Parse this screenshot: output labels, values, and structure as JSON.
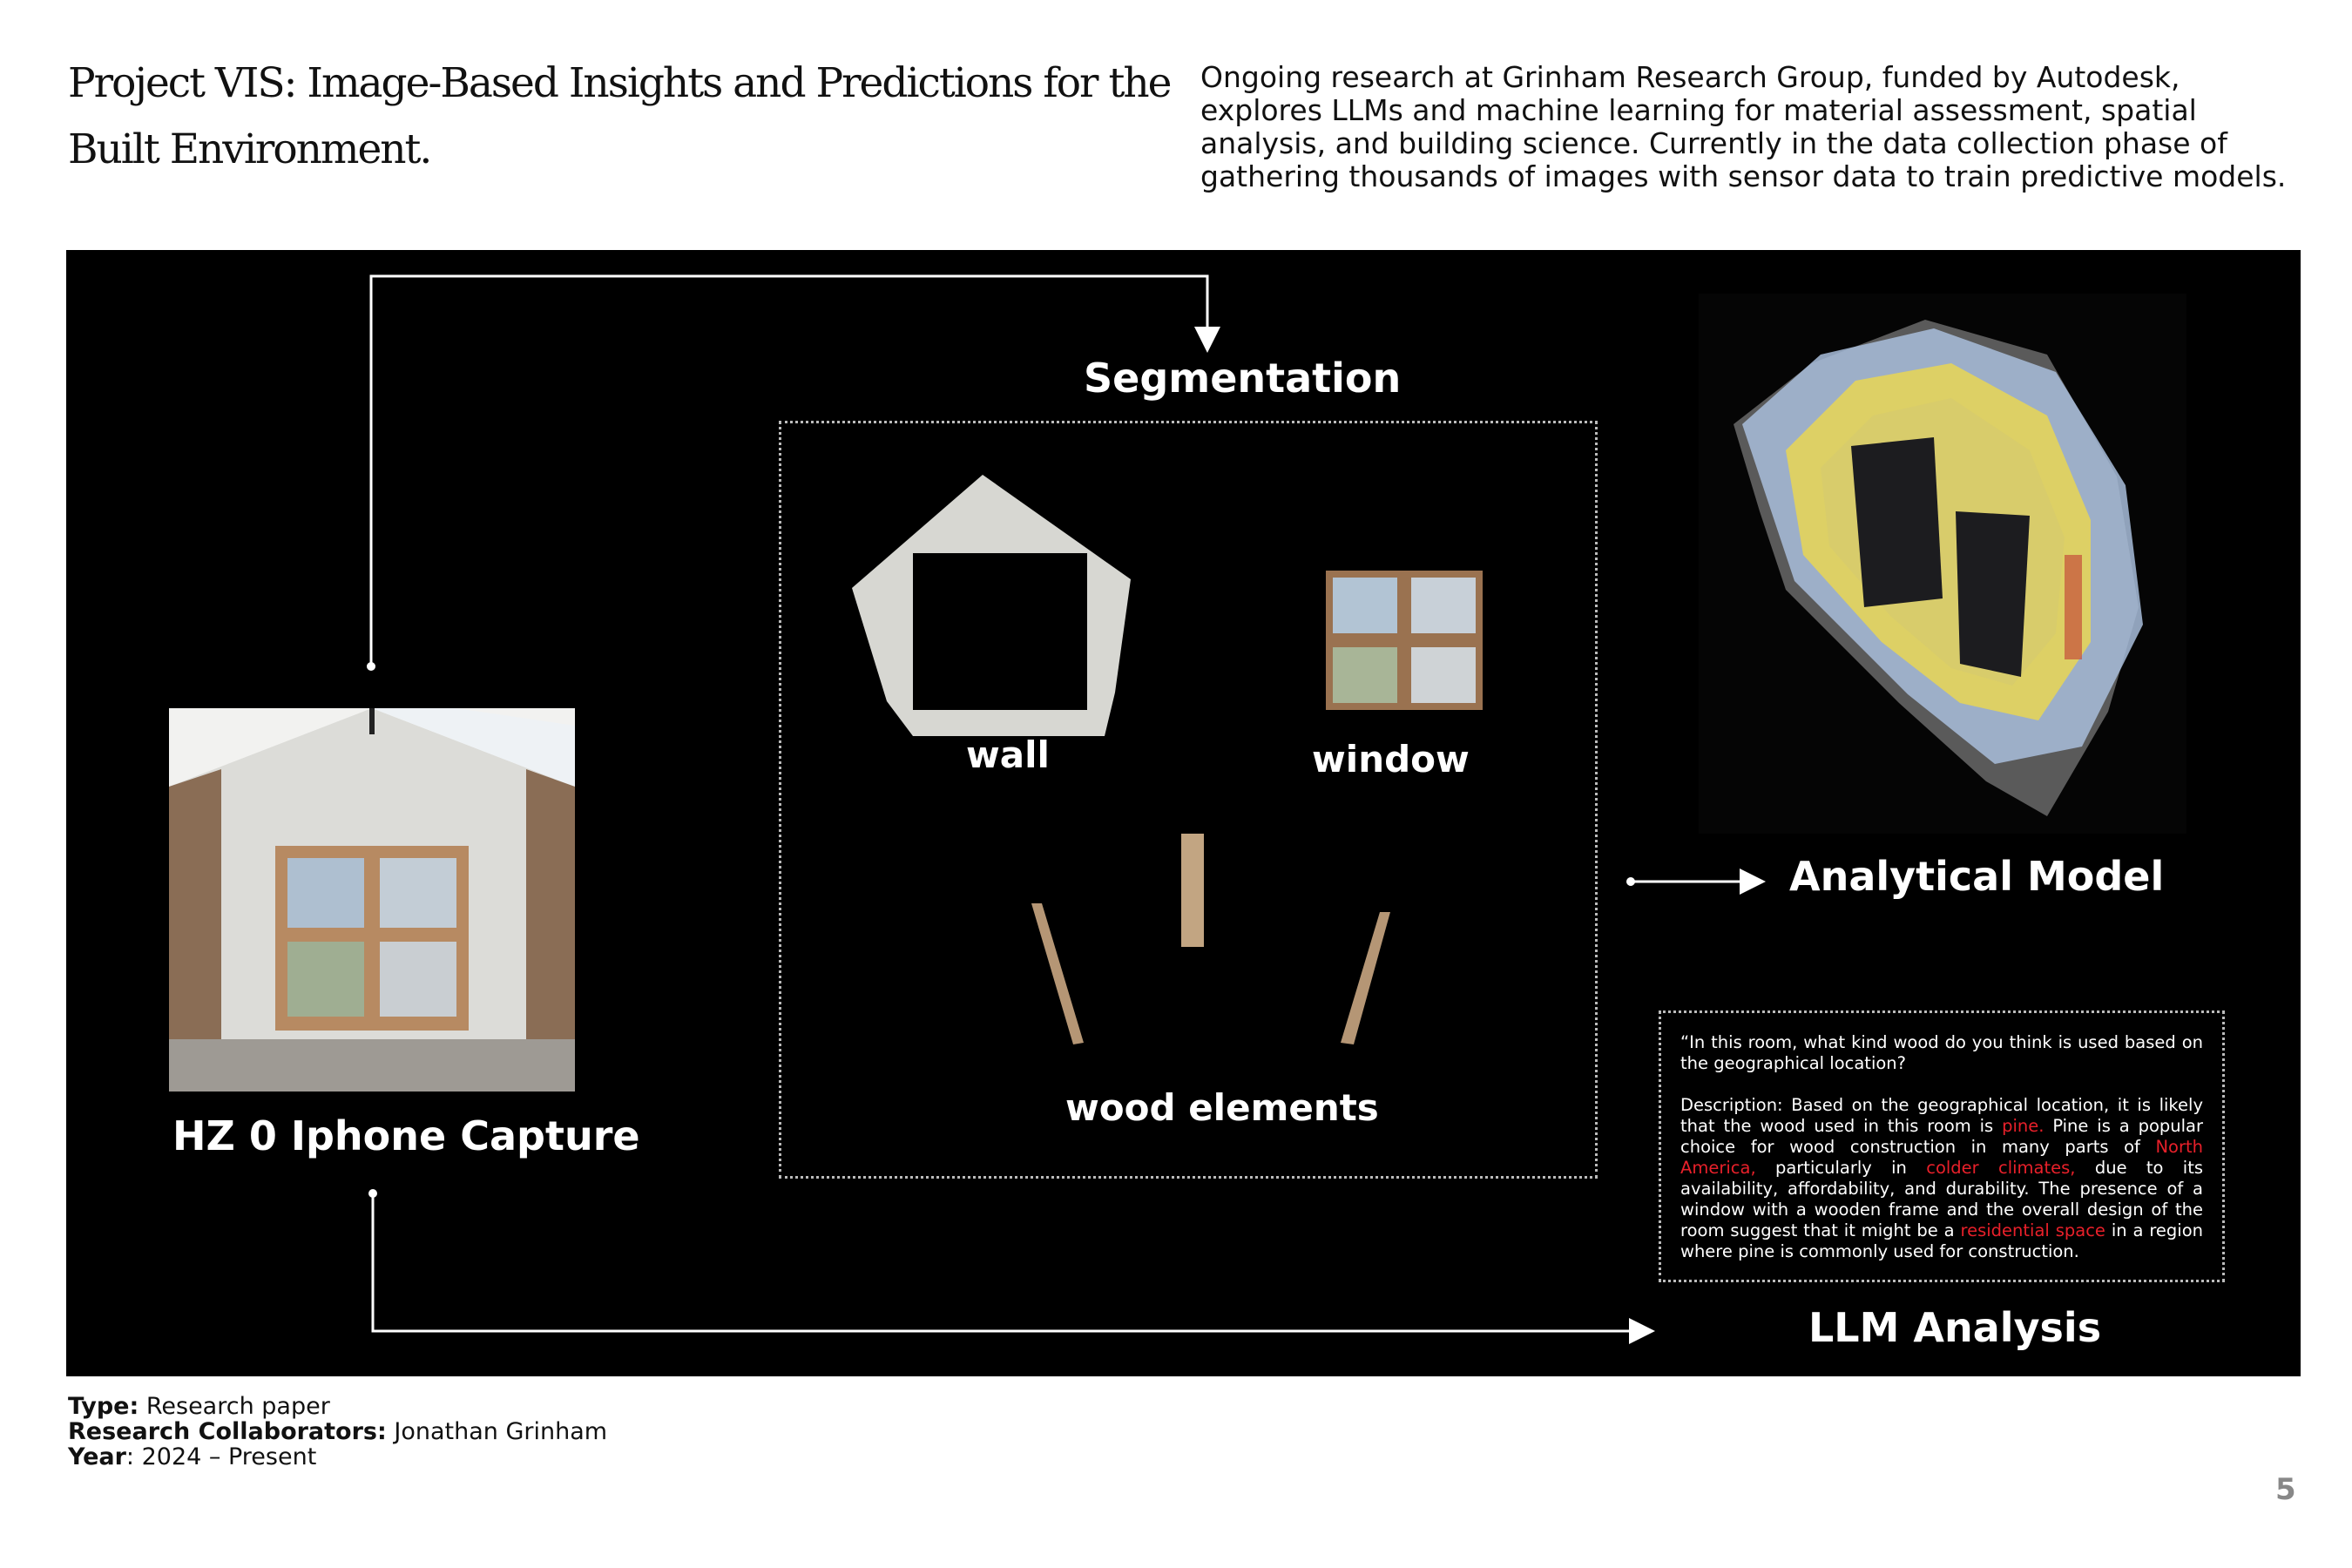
{
  "header": {
    "title": "Project VIS: Image-Based Insights and Predictions for the Built Environment.",
    "intro": "Ongoing research at Grinham Research Group, funded by Autodesk, explores LLMs and machine learning for material assessment, spatial analysis, and building science. Currently in the data collection phase of gathering thousands of images with sensor data to train predictive models."
  },
  "diagram": {
    "capture_label": "HZ 0 Iphone Capture",
    "segmentation_label": "Segmentation",
    "wall_label": "wall",
    "window_label": "window",
    "wood_label": "wood elements",
    "analytical_label": "Analytical Model",
    "llm_label": "LLM Analysis"
  },
  "llm": {
    "question": "“In this room, what kind wood do you think is used based on the geographical location?",
    "answer_1": "Description: Based on the geographical location, it is likely that the wood used in this room is ",
    "hl_1": "pine.",
    "answer_2": " Pine is a popular choice for wood construction in many parts of ",
    "hl_2": "North America,",
    "answer_3": " particularly in ",
    "hl_3": "colder climates,",
    "answer_4": " due to its availability, affordability, and durability. The presence of a window with a wooden frame and the overall design of the room suggest that it might be a ",
    "hl_4": "residential space",
    "answer_5": " in a region where pine is commonly used for construction."
  },
  "meta": {
    "type_label": "Type:",
    "type_value": " Research paper",
    "collab_label": "Research Collaborators:",
    "collab_value": " Jonathan Grinham",
    "year_label": "Year",
    "year_value": ": 2024 – Present"
  },
  "page_number": "5",
  "colors": {
    "panel_bg": "#000000",
    "highlight": "#e8202a",
    "line": "#ffffff"
  }
}
